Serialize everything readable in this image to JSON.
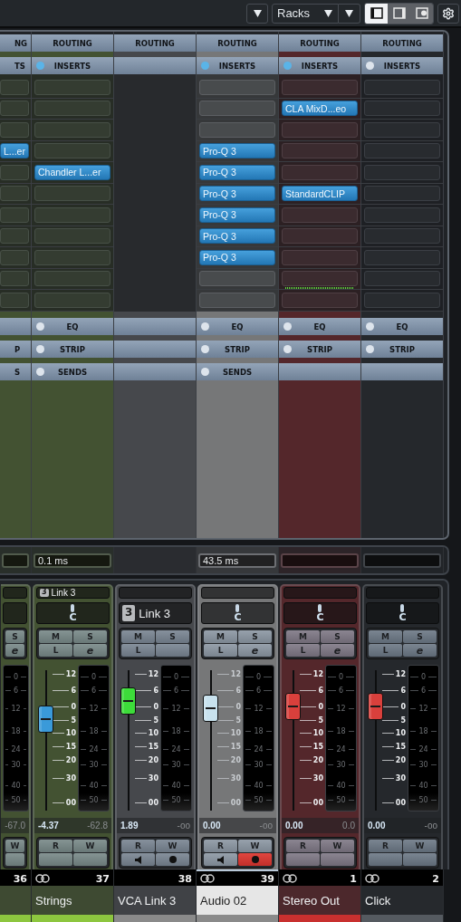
{
  "toolbar": {
    "view_menu": {
      "label": "Racks"
    },
    "panel_toggles": [
      {
        "selected": true
      },
      {
        "selected": false
      },
      {
        "selected": false
      }
    ]
  },
  "channels": [
    {
      "kind": "partial",
      "color": "#435232",
      "track": {
        "color": "#8dc63f"
      },
      "routing": "NG",
      "inserts": {
        "label": "TS"
      },
      "slots": [
        {
          "kind": "empty"
        },
        {
          "kind": "empty"
        },
        {
          "kind": "empty"
        },
        {
          "kind": "plugin",
          "name": "L...er"
        },
        {
          "kind": "empty"
        },
        {
          "kind": "empty"
        },
        {
          "kind": "empty"
        },
        {
          "kind": "empty"
        },
        {
          "kind": "empty"
        },
        {
          "kind": "empty"
        },
        {
          "kind": "empty"
        }
      ],
      "sections": [
        {
          "kind": "blank"
        },
        {
          "kind": "button",
          "label": "P"
        },
        {
          "kind": "button",
          "label": "S"
        }
      ],
      "latency_box": true,
      "buttons": [
        {
          "kind": "label",
          "label": "S"
        },
        {
          "kind": "label",
          "label": "e"
        }
      ],
      "meter_scale": [
        "0",
        "6",
        "12",
        "18",
        "24",
        "30",
        "40",
        "50"
      ],
      "peak": "-67.0",
      "automation": [
        {
          "kind": "label",
          "label": "W"
        },
        {
          "kind": "blank"
        }
      ],
      "number": "36",
      "selected": false
    },
    {
      "kind": "full",
      "color": "#435232",
      "track": {
        "color": "#8dc63f"
      },
      "routing": "ROUTING",
      "inserts": {
        "label": "INSERTS",
        "on": true
      },
      "slots": [
        {
          "kind": "empty"
        },
        {
          "kind": "empty"
        },
        {
          "kind": "empty"
        },
        {
          "kind": "empty"
        },
        {
          "kind": "plugin",
          "name": "Chandler L...er"
        },
        {
          "kind": "empty"
        },
        {
          "kind": "empty"
        },
        {
          "kind": "empty"
        },
        {
          "kind": "empty"
        },
        {
          "kind": "empty"
        },
        {
          "kind": "empty"
        }
      ],
      "sections": [
        {
          "kind": "button",
          "label": "EQ",
          "on": false
        },
        {
          "kind": "button",
          "label": "STRIP",
          "on": false
        },
        {
          "kind": "button",
          "label": "SENDS",
          "on": false
        }
      ],
      "latency_box": true,
      "latency": "0.1 ms",
      "link": {
        "badge": "3",
        "name": "Link 3"
      },
      "pan": "C",
      "buttons": [
        {
          "kind": "label",
          "label": "M"
        },
        {
          "kind": "label",
          "label": "S"
        },
        {
          "kind": "label",
          "label": "L"
        },
        {
          "kind": "label",
          "label": "e"
        }
      ],
      "fader": {
        "level": 0.65,
        "color": "#3a9ad9"
      },
      "fader_scale": [
        "12",
        "6",
        "0",
        "5",
        "10",
        "15",
        "20",
        "30",
        "00"
      ],
      "meter_scale": [
        "0",
        "6",
        "12",
        "18",
        "24",
        "30",
        "40",
        "50"
      ],
      "volume": "-4.37",
      "peak": "-62.8",
      "automation": [
        {
          "kind": "label",
          "label": "R"
        },
        {
          "kind": "label",
          "label": "W"
        },
        {
          "kind": "blank"
        },
        {
          "kind": "blank"
        }
      ],
      "number": "37",
      "stereo": true,
      "name": "Strings",
      "selected": false
    },
    {
      "kind": "full",
      "color": "#46484c",
      "track": {
        "color": "#8a8a8a"
      },
      "routing": "ROUTING",
      "sections": [
        {
          "kind": "blank"
        },
        {
          "kind": "blank"
        },
        {
          "kind": "blank"
        }
      ],
      "latency_box": false,
      "vca": {
        "badge": "3",
        "name": "Link 3"
      },
      "buttons": [
        {
          "kind": "label",
          "label": "M"
        },
        {
          "kind": "label",
          "label": "S"
        },
        {
          "kind": "label",
          "label": "L"
        },
        {
          "kind": "blank"
        }
      ],
      "fader": {
        "level": 0.78,
        "color": "#3ddc3a"
      },
      "fader_scale": [
        "12",
        "6",
        "0",
        "5",
        "10",
        "15",
        "20",
        "30",
        "00"
      ],
      "meter_scale": [
        "0",
        "6",
        "12",
        "18",
        "24",
        "30",
        "40",
        "50"
      ],
      "volume": "1.89",
      "peak": "-oo",
      "automation": [
        {
          "kind": "label",
          "label": "R"
        },
        {
          "kind": "label",
          "label": "W"
        },
        {
          "kind": "monitor"
        },
        {
          "kind": "record",
          "on": false
        }
      ],
      "number": "38",
      "stereo": false,
      "name": "VCA Link 3",
      "selected": false
    },
    {
      "kind": "full",
      "color": "#767778",
      "track": {
        "color": "#8a8a8a"
      },
      "routing": "ROUTING",
      "inserts": {
        "label": "INSERTS",
        "on": true
      },
      "slots": [
        {
          "kind": "empty"
        },
        {
          "kind": "empty"
        },
        {
          "kind": "empty"
        },
        {
          "kind": "plugin",
          "name": "Pro-Q 3"
        },
        {
          "kind": "plugin",
          "name": "Pro-Q 3"
        },
        {
          "kind": "plugin",
          "name": "Pro-Q 3"
        },
        {
          "kind": "plugin",
          "name": "Pro-Q 3"
        },
        {
          "kind": "plugin",
          "name": "Pro-Q 3"
        },
        {
          "kind": "plugin",
          "name": "Pro-Q 3"
        },
        {
          "kind": "empty"
        },
        {
          "kind": "empty"
        }
      ],
      "sections": [
        {
          "kind": "button",
          "label": "EQ",
          "on": false
        },
        {
          "kind": "button",
          "label": "STRIP",
          "on": false
        },
        {
          "kind": "button",
          "label": "SENDS",
          "on": false
        }
      ],
      "latency_box": true,
      "latency": "43.5 ms",
      "pan": "C",
      "buttons": [
        {
          "kind": "label",
          "label": "M"
        },
        {
          "kind": "label",
          "label": "S"
        },
        {
          "kind": "label",
          "label": "L"
        },
        {
          "kind": "label",
          "label": "e"
        }
      ],
      "fader": {
        "level": 0.73,
        "color": "#c8e2ee"
      },
      "fader_scale": [
        "12",
        "6",
        "0",
        "5",
        "10",
        "15",
        "20",
        "30",
        "00"
      ],
      "meter_scale": [
        "0",
        "6",
        "12",
        "18",
        "24",
        "30",
        "40",
        "50"
      ],
      "volume": "0.00",
      "peak": "-oo",
      "automation": [
        {
          "kind": "label",
          "label": "R"
        },
        {
          "kind": "label",
          "label": "W"
        },
        {
          "kind": "monitor"
        },
        {
          "kind": "record",
          "on": true
        }
      ],
      "number": "39",
      "stereo": true,
      "name": "Audio 02",
      "selected": true
    },
    {
      "kind": "full",
      "color": "#54272b",
      "track": {
        "color": "#c8302f"
      },
      "routing": "ROUTING",
      "inserts": {
        "label": "INSERTS",
        "on": true
      },
      "slots": [
        {
          "kind": "empty"
        },
        {
          "kind": "plugin",
          "name": "CLA MixD...eo"
        },
        {
          "kind": "empty"
        },
        {
          "kind": "empty"
        },
        {
          "kind": "empty"
        },
        {
          "kind": "plugin",
          "name": "StandardCLIP"
        },
        {
          "kind": "empty"
        },
        {
          "kind": "empty"
        },
        {
          "kind": "empty"
        },
        {
          "kind": "meter"
        },
        {
          "kind": "empty"
        }
      ],
      "sections": [
        {
          "kind": "button",
          "label": "EQ",
          "on": false
        },
        {
          "kind": "button",
          "label": "STRIP",
          "on": false
        },
        {
          "kind": "blank"
        }
      ],
      "latency_box": true,
      "pan": "C",
      "buttons": [
        {
          "kind": "label",
          "label": "M"
        },
        {
          "kind": "label",
          "label": "S"
        },
        {
          "kind": "label",
          "label": "L"
        },
        {
          "kind": "label",
          "label": "e"
        }
      ],
      "fader": {
        "level": 0.74,
        "color": "#d9403c"
      },
      "fader_scale": [
        "12",
        "6",
        "0",
        "5",
        "10",
        "15",
        "20",
        "30",
        "00"
      ],
      "meter_scale": [
        "0",
        "6",
        "12",
        "18",
        "24",
        "30",
        "40",
        "50"
      ],
      "volume": "0.00",
      "peak": "0.0",
      "automation": [
        {
          "kind": "label",
          "label": "R"
        },
        {
          "kind": "label",
          "label": "W"
        },
        {
          "kind": "blank"
        },
        {
          "kind": "blank"
        }
      ],
      "number": "1",
      "stereo": true,
      "name": "Stereo Out",
      "selected": false
    },
    {
      "kind": "full",
      "color": "#25282c",
      "track": {
        "color": "#555a60"
      },
      "routing": "ROUTING",
      "inserts": {
        "label": "INSERTS",
        "on": false
      },
      "slots": [
        {
          "kind": "empty"
        },
        {
          "kind": "empty"
        },
        {
          "kind": "empty"
        },
        {
          "kind": "empty"
        },
        {
          "kind": "empty"
        },
        {
          "kind": "empty"
        },
        {
          "kind": "empty"
        },
        {
          "kind": "empty"
        },
        {
          "kind": "empty"
        },
        {
          "kind": "empty"
        },
        {
          "kind": "empty"
        }
      ],
      "sections": [
        {
          "kind": "button",
          "label": "EQ",
          "on": false
        },
        {
          "kind": "button",
          "label": "STRIP",
          "on": false
        },
        {
          "kind": "blank"
        }
      ],
      "latency_box": true,
      "pan": "C",
      "buttons": [
        {
          "kind": "label",
          "label": "M"
        },
        {
          "kind": "label",
          "label": "S"
        },
        {
          "kind": "label",
          "label": "L"
        },
        {
          "kind": "label",
          "label": "e"
        }
      ],
      "fader": {
        "level": 0.74,
        "color": "#d9403c"
      },
      "fader_scale": [
        "12",
        "6",
        "0",
        "5",
        "10",
        "15",
        "20",
        "30",
        "00"
      ],
      "meter_scale": [
        "0",
        "6",
        "12",
        "18",
        "24",
        "30",
        "40",
        "50"
      ],
      "volume": "0.00",
      "peak": "-oo",
      "automation": [
        {
          "kind": "label",
          "label": "R"
        },
        {
          "kind": "label",
          "label": "W"
        },
        {
          "kind": "blank"
        },
        {
          "kind": "blank"
        }
      ],
      "number": "2",
      "stereo": true,
      "name": "Click",
      "selected": false
    }
  ]
}
